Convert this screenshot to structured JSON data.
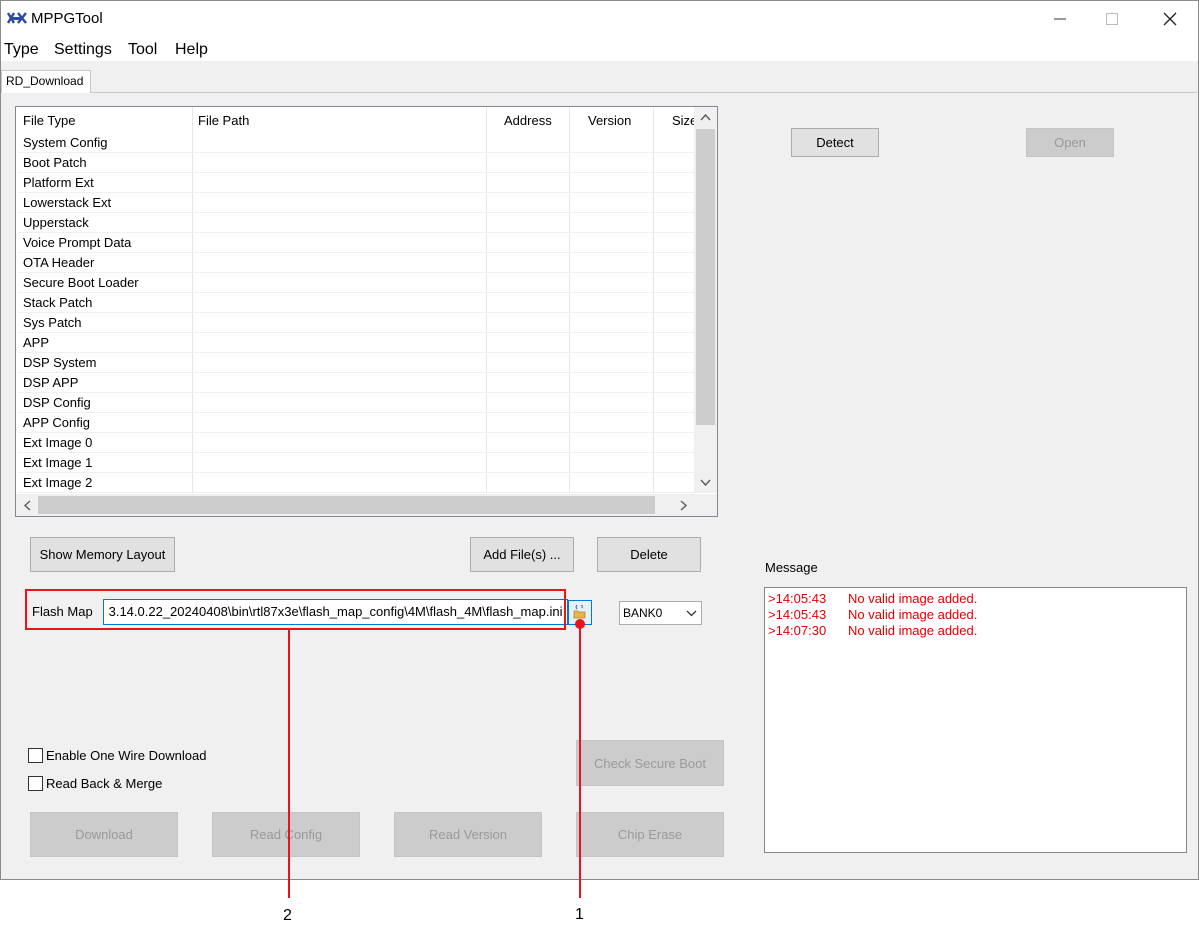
{
  "window": {
    "title": "MPPGTool"
  },
  "menu": [
    "Type",
    "Settings",
    "Tool",
    "Help"
  ],
  "tab": "RD_Download",
  "table": {
    "headers": [
      "File Type",
      "File Path",
      "Address",
      "Version",
      "Size"
    ],
    "rows": [
      "System Config",
      "Boot Patch",
      "Platform Ext",
      "Lowerstack Ext",
      "Upperstack",
      "Voice Prompt Data",
      "OTA Header",
      "Secure Boot Loader",
      "Stack Patch",
      "Sys Patch",
      "APP",
      "DSP System",
      "DSP APP",
      "DSP Config",
      "APP Config",
      "Ext Image 0",
      "Ext Image 1",
      "Ext Image 2"
    ]
  },
  "buttons": {
    "detect": "Detect",
    "open": "Open",
    "show_memory_layout": "Show Memory Layout",
    "add_files": "Add File(s) ...",
    "delete": "Delete",
    "check_secure_boot": "Check Secure Boot",
    "download": "Download",
    "read_config": "Read Config",
    "read_version": "Read Version",
    "chip_erase": "Chip Erase"
  },
  "flash_map": {
    "label": "Flash Map",
    "value": " 3.14.0.22_20240408\\bin\\rtl87x3e\\flash_map_config\\4M\\flash_4M\\flash_map.ini",
    "bank": "BANK0"
  },
  "checkboxes": {
    "one_wire": "Enable One Wire Download",
    "read_back": "Read Back & Merge"
  },
  "message": {
    "label": "Message",
    "lines": [
      {
        "time": ">14:05:43",
        "text": "No valid image added."
      },
      {
        "time": ">14:05:43",
        "text": "No valid image added."
      },
      {
        "time": ">14:07:30",
        "text": "No valid image added."
      }
    ]
  },
  "annotations": [
    "2",
    "1"
  ],
  "colors": {
    "annotation": "#e8141c",
    "message_text": "#e00000"
  }
}
